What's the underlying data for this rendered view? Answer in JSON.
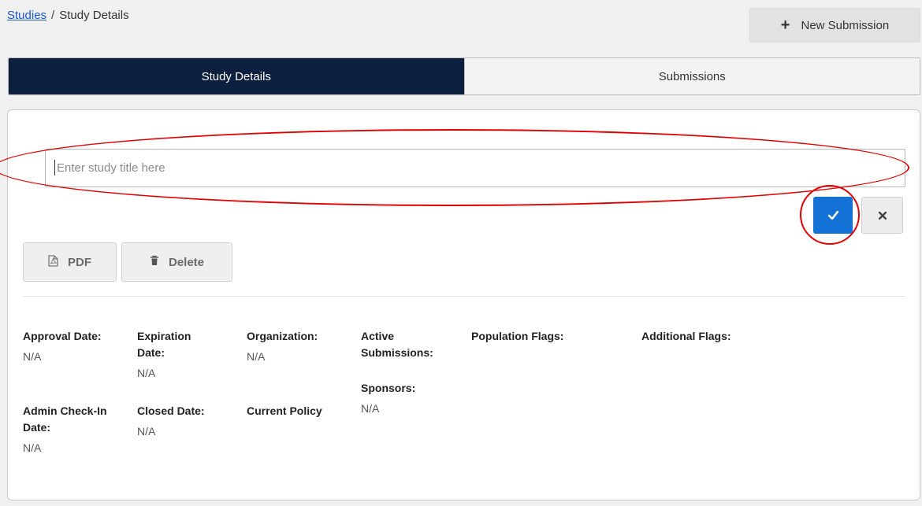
{
  "breadcrumb": {
    "link": "Studies",
    "separator": "/",
    "current": "Study Details"
  },
  "header": {
    "new_submission_label": "New Submission",
    "new_submission_icon": "plus-icon"
  },
  "tabs": [
    {
      "label": "Study Details",
      "active": true
    },
    {
      "label": "Submissions",
      "active": false
    }
  ],
  "title_input": {
    "value": "",
    "placeholder": "Enter study title here"
  },
  "actions": {
    "confirm_icon": "check-icon",
    "cancel_icon": "close-icon",
    "pdf_label": "PDF",
    "delete_label": "Delete"
  },
  "fields": {
    "approval_date": {
      "label": "Approval Date:",
      "value": "N/A"
    },
    "expiration_date": {
      "label": "Expiration Date:",
      "value": "N/A"
    },
    "organization": {
      "label": "Organization:",
      "value": "N/A"
    },
    "active_submissions": {
      "label": "Active Submissions:",
      "value": ""
    },
    "sponsors": {
      "label": "Sponsors:",
      "value": "N/A"
    },
    "population_flags": {
      "label": "Population Flags:",
      "value": ""
    },
    "additional_flags": {
      "label": "Additional Flags:",
      "value": ""
    },
    "admin_check_in_date": {
      "label": "Admin Check-In Date:",
      "value": "N/A"
    },
    "closed_date": {
      "label": "Closed Date:",
      "value": "N/A"
    },
    "current_policy": {
      "label": "Current Policy",
      "value": ""
    }
  },
  "colors": {
    "active_tab": "#0c1f3f",
    "confirm_button": "#1472d6",
    "annotation": "#e00000",
    "link": "#1a56c9"
  }
}
